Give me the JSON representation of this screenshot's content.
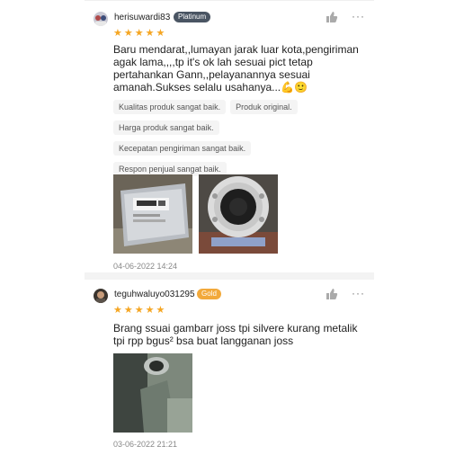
{
  "reviews": [
    {
      "username": "herisuwardi83",
      "badge": "Platinum",
      "rating": 5,
      "comment": "Baru mendarat,,lumayan jarak luar kota,pengiriman agak lama,,,,tp it's ok lah sesuai pict tetap pertahankan Gann,,pelayanannya sesuai amanah.Sukses selalu usahanya...💪🙂",
      "tags": [
        "Kualitas produk sangat baik.",
        "Produk original.",
        "Harga produk sangat baik.",
        "Kecepatan pengiriman sangat baik.",
        "Respon penjual sangat baik."
      ],
      "date": "04-06-2022 14:24"
    },
    {
      "username": "teguhwaluyo031295",
      "badge": "Gold",
      "rating": 5,
      "comment": "Brang ssuai gambarr joss tpi silvere kurang metalik tpi rpp bgus² bsa buat langganan joss",
      "tags": [],
      "date": "03-06-2022 21:21"
    }
  ],
  "colors": {
    "star": "#f5a623",
    "platinum_badge": "#4a5563",
    "gold_badge": "#f2a93b"
  },
  "icons": {
    "like": "thumbs-up-icon",
    "more": "more-options-icon"
  },
  "ui": {
    "more_label": "···"
  }
}
